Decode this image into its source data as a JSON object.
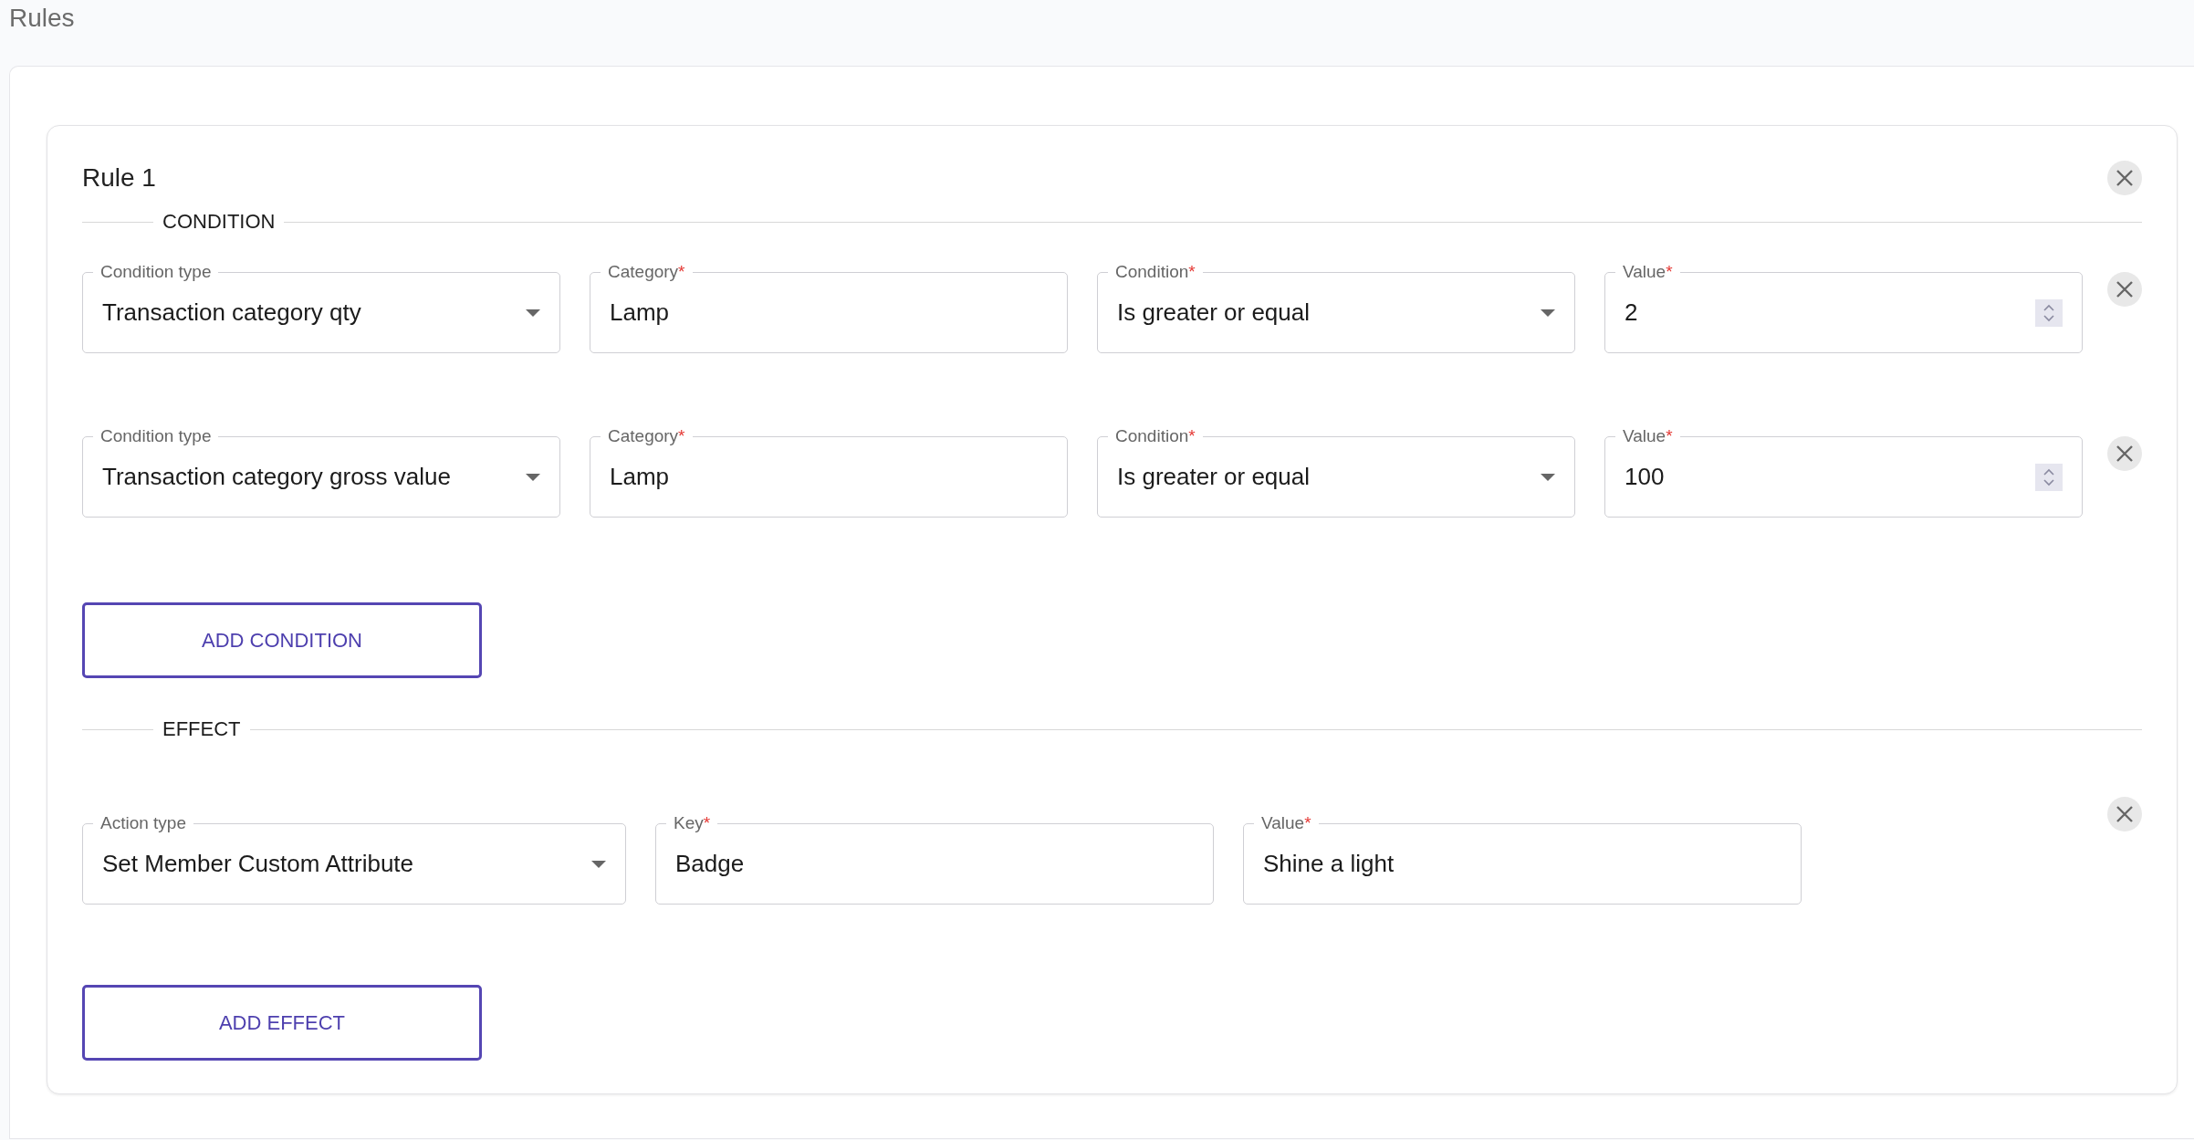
{
  "page_title": "Rules",
  "rule": {
    "title": "Rule 1",
    "condition_section": {
      "heading": "CONDITION",
      "rows": [
        {
          "fields": [
            {
              "kind": "select",
              "label": "Condition type",
              "value": "Transaction category qty"
            },
            {
              "kind": "text",
              "label": "Category",
              "required_mark": "*",
              "value": "Lamp"
            },
            {
              "kind": "select",
              "label": "Condition",
              "required_mark": "*",
              "value": "Is greater or equal"
            },
            {
              "kind": "number",
              "label": "Value",
              "required_mark": "*",
              "value": "2"
            }
          ]
        },
        {
          "fields": [
            {
              "kind": "select",
              "label": "Condition type",
              "value": "Transaction category gross value"
            },
            {
              "kind": "text",
              "label": "Category",
              "required_mark": "*",
              "value": "Lamp"
            },
            {
              "kind": "select",
              "label": "Condition",
              "required_mark": "*",
              "value": "Is greater or equal"
            },
            {
              "kind": "number",
              "label": "Value",
              "required_mark": "*",
              "value": "100"
            }
          ]
        }
      ],
      "add_button": "ADD CONDITION"
    },
    "effect_section": {
      "heading": "EFFECT",
      "rows": [
        {
          "fields": [
            {
              "kind": "select",
              "label": "Action type",
              "value": "Set Member Custom Attribute"
            },
            {
              "kind": "text",
              "label": "Key",
              "required_mark": "*",
              "value": "Badge"
            },
            {
              "kind": "text",
              "label": "Value",
              "required_mark": "*",
              "value": "Shine a light"
            }
          ]
        }
      ],
      "add_button": "ADD EFFECT"
    }
  }
}
